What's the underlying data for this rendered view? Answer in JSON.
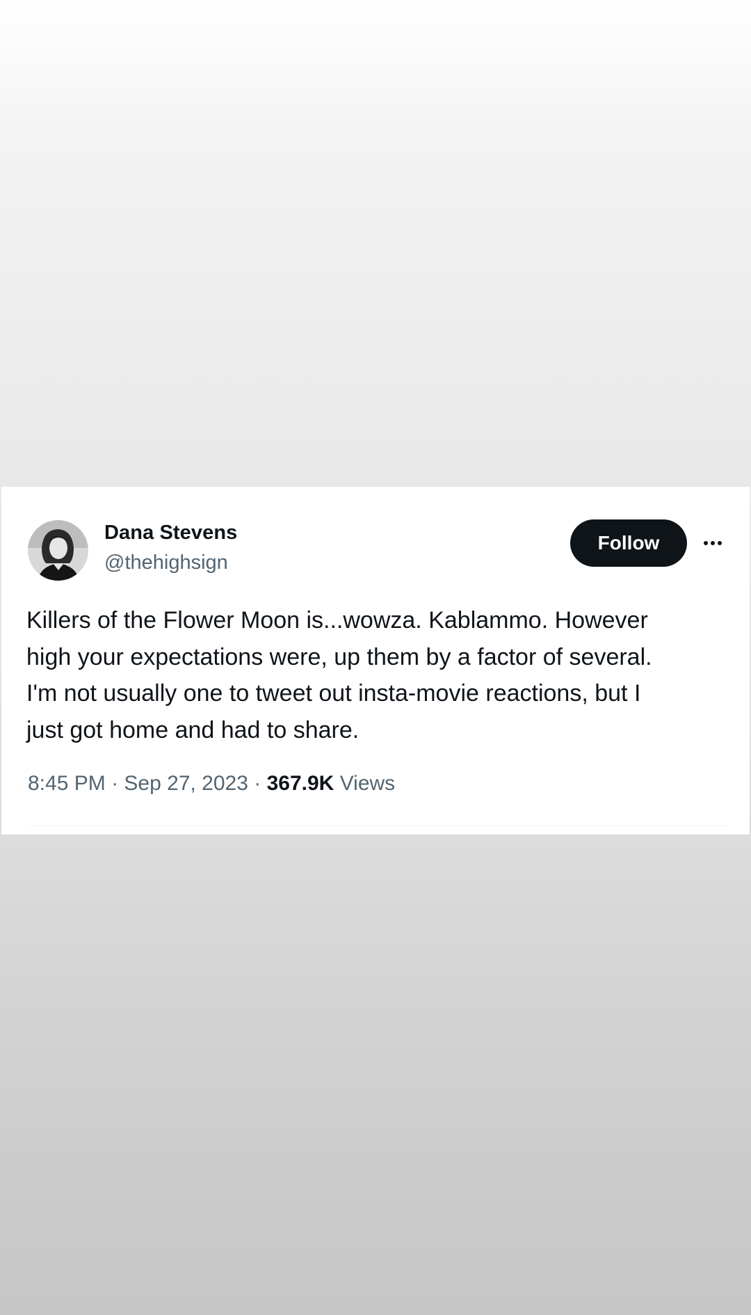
{
  "tweet": {
    "author": {
      "display_name": "Dana Stevens",
      "handle": "@thehighsign"
    },
    "follow_label": "Follow",
    "more_icon": "more-horizontal-icon",
    "text": "Killers of the Flower Moon is...wowza. Kablammo. However\nhigh your expectations were, up them by a factor of several.\nI'm not usually one to tweet out insta-movie reactions, but I\njust got home and had to share.",
    "time": "8:45 PM",
    "separator": "·",
    "date": "Sep 27, 2023",
    "views_count": "367.9K",
    "views_label": "Views"
  },
  "colors": {
    "text_primary": "#0f1419",
    "text_secondary": "#536471",
    "follow_bg": "#0f1419",
    "card_bg": "#ffffff"
  }
}
